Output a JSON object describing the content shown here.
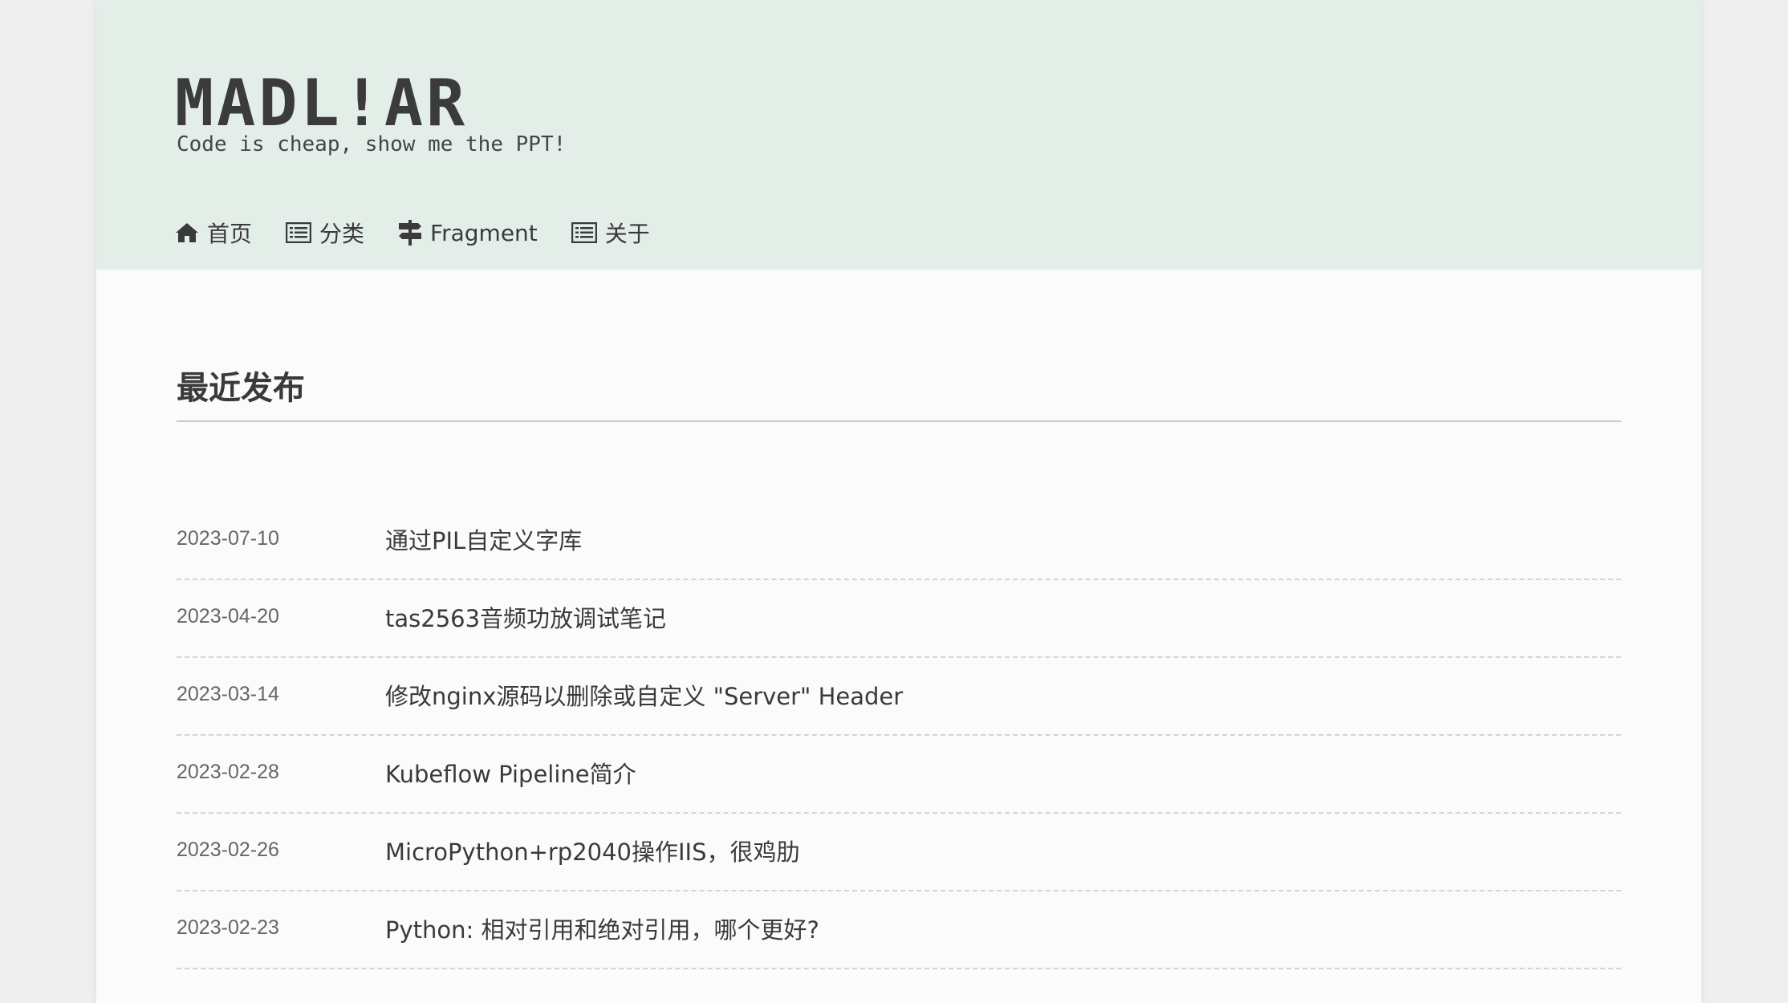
{
  "site": {
    "logo": "MADL!AR",
    "tagline": "Code is cheap, show me the PPT!"
  },
  "nav": {
    "items": [
      {
        "icon": "home-icon",
        "label": "首页"
      },
      {
        "icon": "list-icon",
        "label": "分类"
      },
      {
        "icon": "signpost-icon",
        "label": "Fragment"
      },
      {
        "icon": "list-icon",
        "label": "关于"
      }
    ]
  },
  "main": {
    "section_title": "最近发布",
    "posts": [
      {
        "date": "2023-07-10",
        "title": "通过PIL自定义字库"
      },
      {
        "date": "2023-04-20",
        "title": "tas2563音频功放调试笔记"
      },
      {
        "date": "2023-03-14",
        "title": "修改nginx源码以删除或自定义 \"Server\" Header"
      },
      {
        "date": "2023-02-28",
        "title": "Kubeflow Pipeline简介"
      },
      {
        "date": "2023-02-26",
        "title": "MicroPython+rp2040操作IIS，很鸡肋"
      },
      {
        "date": "2023-02-23",
        "title": "Python: 相对引用和绝对引用，哪个更好?"
      }
    ]
  },
  "colors": {
    "header_bg": "#e4eee9",
    "page_bg": "#fbfbfb",
    "outer_bg": "#efefef",
    "text": "#3a3a3a"
  }
}
